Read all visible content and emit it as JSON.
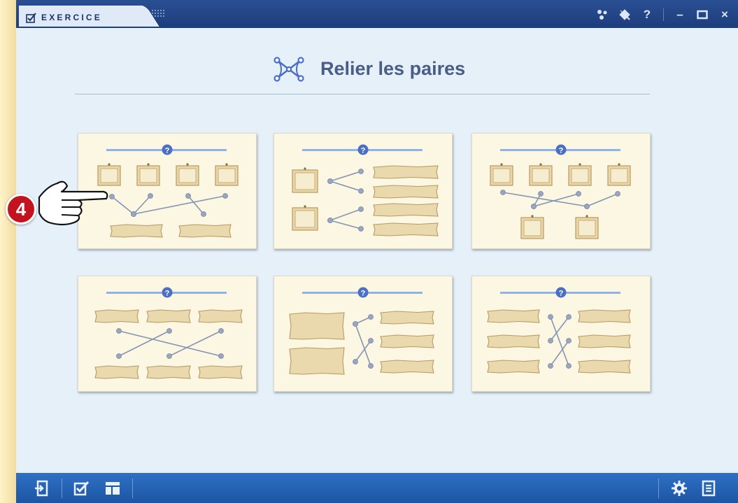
{
  "titlebar": {
    "app_label": "EXERCICE",
    "icons": [
      "share-icon",
      "pin-icon",
      "help-icon",
      "minimize-icon",
      "maximize-icon",
      "close-icon"
    ],
    "help_glyph": "?",
    "min_glyph": "–",
    "close_glyph": "×"
  },
  "page": {
    "title": "Relier les paires",
    "title_icon": "link-pairs-icon"
  },
  "cards": [
    {
      "name": "layout-card-1",
      "help_glyph": "?"
    },
    {
      "name": "layout-card-2",
      "help_glyph": "?"
    },
    {
      "name": "layout-card-3",
      "help_glyph": "?"
    },
    {
      "name": "layout-card-4",
      "help_glyph": "?"
    },
    {
      "name": "layout-card-5",
      "help_glyph": "?"
    },
    {
      "name": "layout-card-6",
      "help_glyph": "?"
    }
  ],
  "step_marker": {
    "number": "4"
  },
  "bottombar": {
    "left_icons": [
      "exit-icon",
      "check-edit-icon",
      "layout-icon"
    ],
    "right_icons": [
      "settings-icon",
      "notes-icon"
    ]
  },
  "colors": {
    "titlebar": "#1d3d7c",
    "bottombar": "#1c55a3",
    "content_bg": "#e6f0f9",
    "card_bg": "#fbf7e3",
    "accent": "#4a6fc4",
    "marker_red": "#c2131e"
  }
}
